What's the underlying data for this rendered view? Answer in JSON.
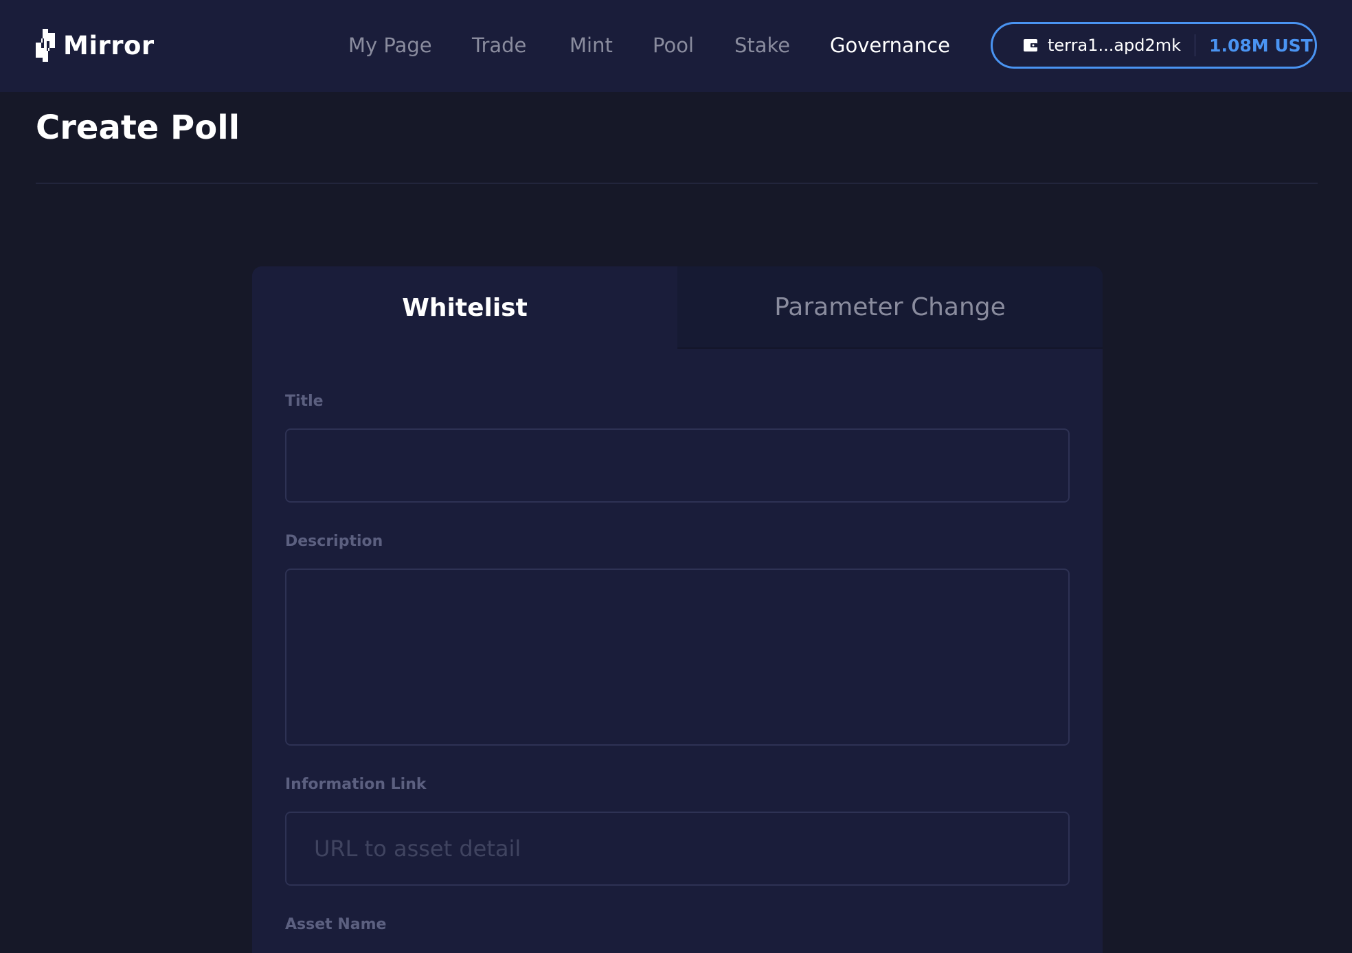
{
  "header": {
    "logo_text": "Mirror",
    "nav": [
      {
        "label": "My Page",
        "active": false
      },
      {
        "label": "Trade",
        "active": false
      },
      {
        "label": "Mint",
        "active": false
      },
      {
        "label": "Pool",
        "active": false
      },
      {
        "label": "Stake",
        "active": false
      },
      {
        "label": "Governance",
        "active": true
      }
    ],
    "wallet": {
      "icon": "wallet-icon",
      "address": "terra1...apd2mk",
      "balance": "1.08M UST"
    }
  },
  "page": {
    "title": "Create Poll"
  },
  "form": {
    "tabs": [
      {
        "label": "Whitelist",
        "active": true
      },
      {
        "label": "Parameter Change",
        "active": false
      }
    ],
    "fields": {
      "title": {
        "label": "Title",
        "value": "",
        "placeholder": ""
      },
      "description": {
        "label": "Description",
        "value": "",
        "placeholder": ""
      },
      "info_link": {
        "label": "Information Link",
        "value": "",
        "placeholder": "URL to asset detail"
      },
      "asset_name": {
        "label": "Asset Name"
      }
    }
  },
  "colors": {
    "background": "#161828",
    "header": "#1a1d3a",
    "accent": "#4a94f2",
    "muted_text": "#8a8c9e"
  }
}
